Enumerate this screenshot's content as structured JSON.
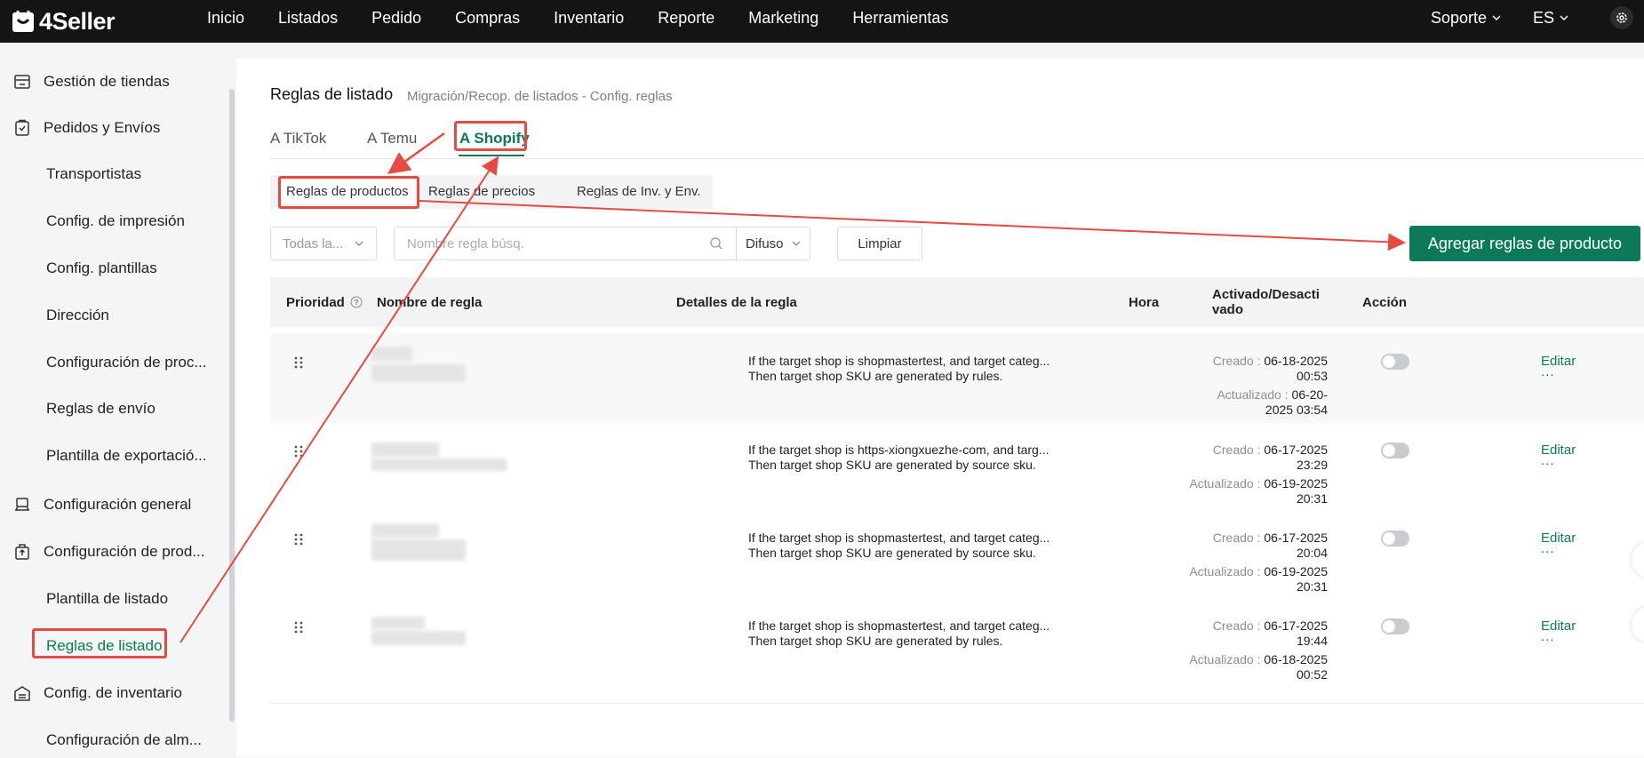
{
  "app": {
    "logo_text": "4Seller"
  },
  "nav": [
    {
      "label": "Inicio"
    },
    {
      "label": "Listados"
    },
    {
      "label": "Pedido"
    },
    {
      "label": "Compras"
    },
    {
      "label": "Inventario"
    },
    {
      "label": "Reporte"
    },
    {
      "label": "Marketing"
    },
    {
      "label": "Herramientas"
    }
  ],
  "top_right": {
    "support": "Soporte",
    "lang": "ES",
    "settings_icon": "gear-icon"
  },
  "sidebar": {
    "groups": [
      {
        "label": "Gestión de tiendas",
        "icon": "store-icon"
      },
      {
        "label": "Pedidos y Envíos",
        "icon": "clipboard-icon"
      },
      {
        "label": "Configuración general",
        "icon": "printer-icon"
      },
      {
        "label": "Configuración de prod...",
        "icon": "box-icon"
      },
      {
        "label": "Config. de inventario",
        "icon": "warehouse-icon"
      }
    ],
    "subitems": [
      {
        "label": "Transportistas"
      },
      {
        "label": "Config. de impresión"
      },
      {
        "label": "Config. plantillas"
      },
      {
        "label": "Dirección"
      },
      {
        "label": "Configuración de proc..."
      },
      {
        "label": "Reglas de envío"
      },
      {
        "label": "Plantilla de exportació..."
      },
      {
        "label": "Plantilla de listado"
      },
      {
        "label": "Reglas de listado"
      },
      {
        "label": "Configuración de alm..."
      }
    ]
  },
  "page": {
    "title": "Reglas de listado",
    "breadcrumb": "Migración/Recop. de listados - Config. reglas",
    "tabs": [
      {
        "label": "A TikTok"
      },
      {
        "label": "A Temu"
      },
      {
        "label": "A Shopify"
      }
    ],
    "subtabs": [
      {
        "label": "Reglas de productos"
      },
      {
        "label": "Reglas de precios"
      },
      {
        "label": "Reglas de Inv. y Env."
      }
    ]
  },
  "filters": {
    "store_select": "Todas la...",
    "search_placeholder": "Nombre regla búsq.",
    "match_select": "Difuso",
    "clear_button": "Limpiar",
    "add_button": "Agregar reglas de producto"
  },
  "table": {
    "headers": {
      "priority": "Prioridad",
      "name": "Nombre de regla",
      "details": "Detalles de la regla",
      "time": "Hora",
      "enabled_1": "Activado/Desacti",
      "enabled_2": "vado",
      "action": "Acción"
    },
    "rows": [
      {
        "detail_1": "If the target shop is shopmastertest, and target categ...",
        "detail_2": "Then target shop SKU are generated by rules.",
        "created_label": "Creado :",
        "created_1": "06-18-2025",
        "created_2": "00:53",
        "updated_label": "Actualizado :",
        "updated_1": "06-20-",
        "updated_2": "2025 03:54",
        "enabled": false,
        "edit": "Editar",
        "more": "..."
      },
      {
        "detail_1": "If the target shop is https-xiongxuezhe-com, and targ...",
        "detail_2": "Then target shop SKU are generated by source sku.",
        "created_label": "Creado :",
        "created_1": "06-17-2025",
        "created_2": "23:29",
        "updated_label": "Actualizado :",
        "updated_1": "06-19-2025",
        "updated_2": "20:31",
        "enabled": false,
        "edit": "Editar",
        "more": "..."
      },
      {
        "detail_1": "If the target shop is shopmastertest, and target categ...",
        "detail_2": "Then target shop SKU are generated by source sku.",
        "created_label": "Creado :",
        "created_1": "06-17-2025",
        "created_2": "20:04",
        "updated_label": "Actualizado :",
        "updated_1": "06-19-2025",
        "updated_2": "20:31",
        "enabled": false,
        "edit": "Editar",
        "more": "..."
      },
      {
        "detail_1": "If the target shop is shopmastertest, and target categ...",
        "detail_2": "Then target shop SKU are generated by rules.",
        "created_label": "Creado :",
        "created_1": "06-17-2025",
        "created_2": "19:44",
        "updated_label": "Actualizado :",
        "updated_1": "06-18-2025",
        "updated_2": "00:52",
        "enabled": false,
        "edit": "Editar",
        "more": "..."
      }
    ]
  },
  "colors": {
    "accent": "#0c7a5a",
    "annotation": "#e54b3f",
    "topbar": "#141414"
  }
}
